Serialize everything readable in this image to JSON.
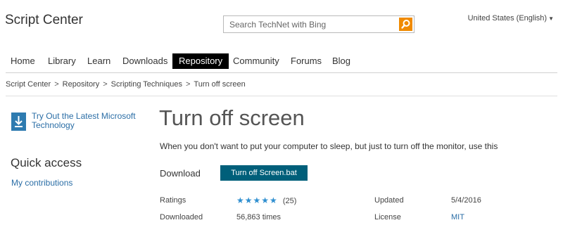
{
  "header": {
    "site_title": "Script Center",
    "search": {
      "placeholder": "Search TechNet with Bing",
      "value": ""
    },
    "locale": "United States (English)"
  },
  "nav": {
    "items": [
      {
        "label": "Home"
      },
      {
        "label": "Library"
      },
      {
        "label": "Learn"
      },
      {
        "label": "Downloads"
      },
      {
        "label": "Repository"
      },
      {
        "label": "Community"
      },
      {
        "label": "Forums"
      },
      {
        "label": "Blog"
      }
    ],
    "active_item": "Repository"
  },
  "breadcrumb": {
    "items": [
      "Script Center",
      "Repository",
      "Scripting Techniques",
      "Turn off screen"
    ],
    "separator": ">"
  },
  "sidebar": {
    "promo_text": "Try Out the Latest Microsoft Technology",
    "quick_access_title": "Quick access",
    "quick_access_link": "My contributions"
  },
  "main": {
    "title": "Turn off screen",
    "description": "When you don't want to put your computer to sleep, but just to turn off the monitor, use this",
    "download_label": "Download",
    "download_button": "Turn off Screen.bat",
    "meta": {
      "ratings_label": "Ratings",
      "stars": "★★★★★",
      "rating_value": 5,
      "ratings_count": "(25)",
      "downloaded_label": "Downloaded",
      "downloaded_value": "56,863 times",
      "updated_label": "Updated",
      "updated_value": "5/4/2016",
      "license_label": "License",
      "license_value": "MIT"
    }
  },
  "colors": {
    "active_nav_bg": "#000000",
    "download_button_bg": "#005f7a",
    "search_button_bg": "#f08a00",
    "link": "#2b6ea6",
    "stars": "#2f8fd0"
  }
}
